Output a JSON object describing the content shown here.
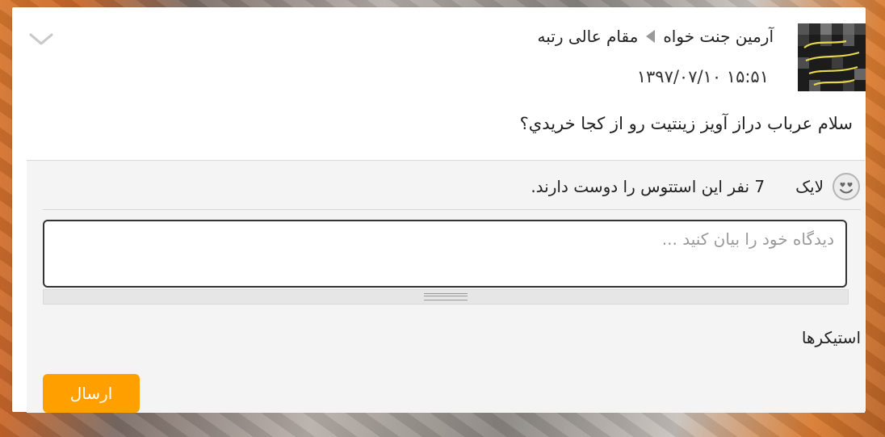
{
  "post": {
    "author": "آرمین جنت خواه",
    "recipient": "مقام عالی رتبه",
    "timestamp": "۱۳۹۷/۰۷/۱۰ ۱۵:۵۱",
    "text": "سلام عرباب دراز آويز زينتيت رو از كجا خريدي؟"
  },
  "likes": {
    "like_label": "لایک",
    "count_text": "7 نفر این استتوس را دوست دارند."
  },
  "comment": {
    "placeholder": "دیدگاه خود را بیان کنید ..."
  },
  "stickers_label": "استیکرها",
  "send_label": "ارسال",
  "icons": {
    "collapse": "chevron-down-icon",
    "like": "smiley-heart-eyes-icon",
    "separator": "triangle-left-icon"
  },
  "colors": {
    "send_button": "#ffa000",
    "panel": "#f4f4f4"
  }
}
